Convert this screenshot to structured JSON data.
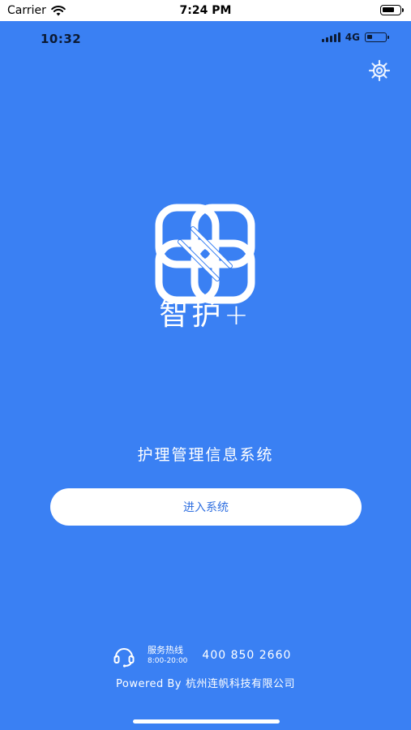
{
  "system_status": {
    "carrier": "Carrier",
    "time": "7:24 PM",
    "wifi_icon": "wifi-icon",
    "battery_icon": "battery-icon"
  },
  "app_status": {
    "time": "10:32",
    "network": "4G",
    "signal_icon": "signal-icon",
    "battery_icon": "battery-icon"
  },
  "header": {
    "settings_icon": "gear-icon"
  },
  "logo": {
    "icon": "knot-logo-icon",
    "brand": "智护+"
  },
  "main": {
    "subtitle": "护理管理信息系统",
    "enter_button": "进入系统"
  },
  "footer": {
    "hotline_icon": "headset-icon",
    "hotline_label": "服务热线",
    "hotline_hours": "8:00-20:00",
    "hotline_number": "400 850 2660",
    "powered_prefix": "Powered By",
    "company": "杭州连帆科技有限公司"
  },
  "colors": {
    "background": "#3a80f3",
    "button_text": "#2f6fe0",
    "status_dark": "#0c1a33"
  }
}
